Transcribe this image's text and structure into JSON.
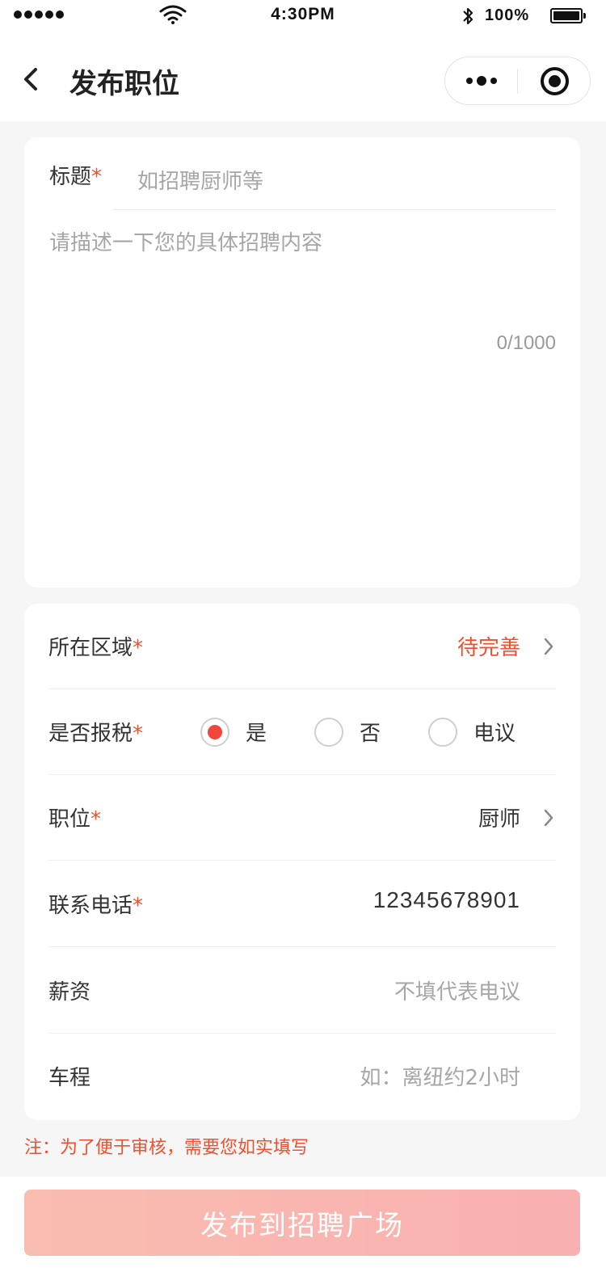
{
  "status_bar": {
    "time": "4:30PM",
    "battery": "100%",
    "icons": [
      "signal-dots-icon",
      "wifi-icon",
      "bluetooth-icon",
      "battery-icon"
    ]
  },
  "nav": {
    "title": "发布职位",
    "icons": [
      "back-arrow-icon",
      "more-dots-icon",
      "target-icon"
    ]
  },
  "card1": {
    "title_label": "标题",
    "required_mark": "*",
    "title_placeholder": "如招聘厨师等",
    "title_value": "",
    "desc_placeholder": "请描述一下您的具体招聘内容",
    "desc_value": "",
    "counter": "0/1000"
  },
  "card2": {
    "region": {
      "label": "所在区域",
      "required": "*",
      "value": "待完善"
    },
    "tax": {
      "label": "是否报税",
      "required": "*",
      "options": [
        "是",
        "否",
        "电议"
      ],
      "selected": "是"
    },
    "position": {
      "label": "职位",
      "required": "*",
      "value": "厨师"
    },
    "phone": {
      "label": "联系电话",
      "required": "*",
      "value": "12345678901"
    },
    "salary": {
      "label": "薪资",
      "placeholder": "不填代表电议"
    },
    "commute": {
      "label": "车程",
      "placeholder": "如：离纽约2小时"
    }
  },
  "note": "注：为了便于审核，需要您如实填写",
  "submit_label": "发布到招聘广场",
  "colors": {
    "accent": "#f0502e",
    "radio_selected": "#f0473a",
    "submit_bg": "#f9b8b0",
    "page_bg": "#f6f6f6"
  }
}
